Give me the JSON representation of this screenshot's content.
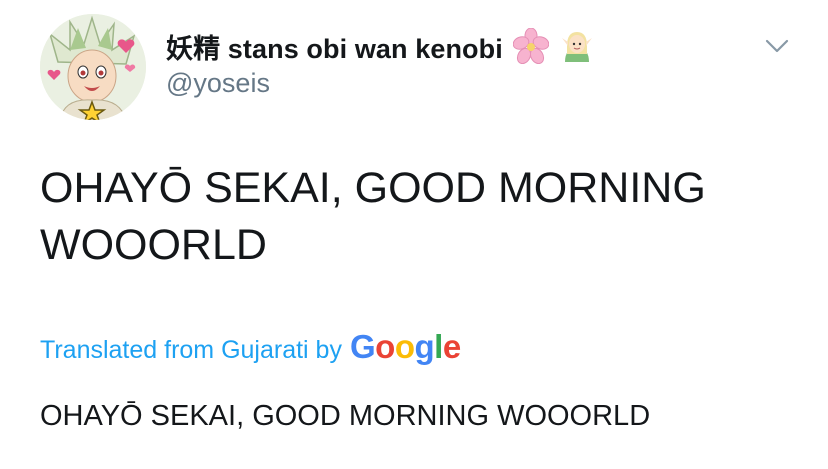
{
  "tweet": {
    "avatar_icon": "anime-character-avatar",
    "display_name": "妖精 stans obi wan kenobi",
    "display_name_emojis": [
      "cherry-blossom-emoji",
      "elf-emoji"
    ],
    "handle": "@yoseis",
    "menu_icon": "chevron-down-icon",
    "text": "OHAYŌ SEKAI, GOOD MORNING WOOORLD",
    "translation": {
      "label": "Translated from Gujarati by",
      "provider_letters": [
        "G",
        "o",
        "o",
        "g",
        "l",
        "e"
      ],
      "translated_text": "OHAYŌ SEKAI, GOOD MORNING WOOORLD"
    },
    "colors": {
      "link": "#1da1f2",
      "secondary_text": "#657786",
      "primary_text": "#14171a"
    }
  }
}
